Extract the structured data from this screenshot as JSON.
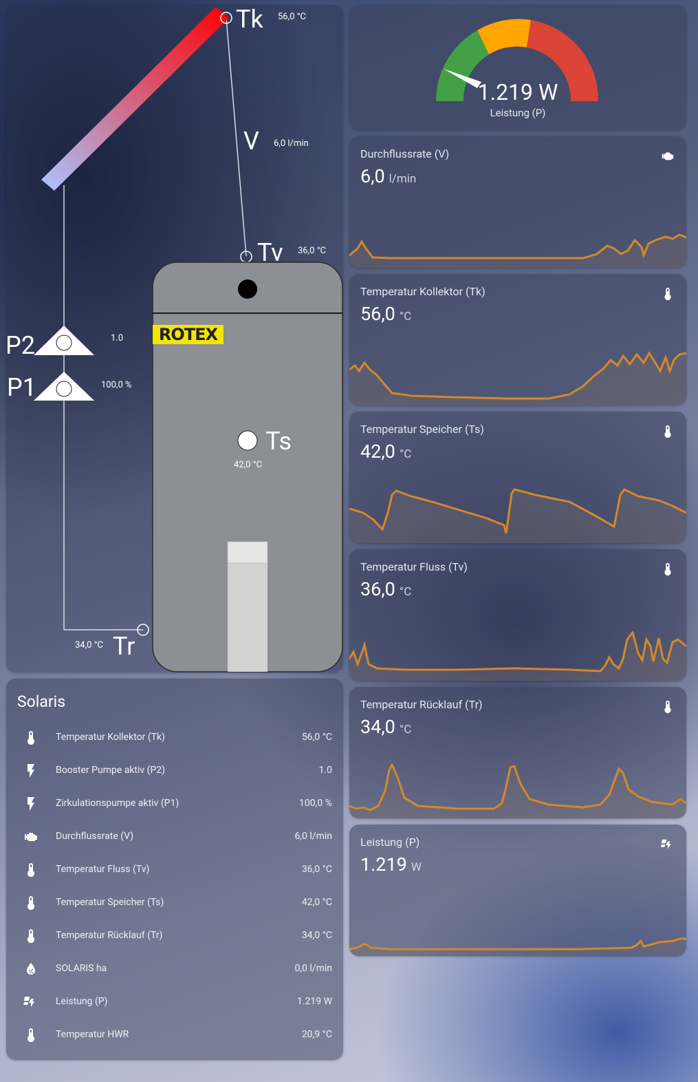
{
  "diagram": {
    "tk": {
      "label": "Tk",
      "value": "56,0 °C"
    },
    "v": {
      "label": "V",
      "value": "6,0 l/min"
    },
    "tv": {
      "label": "Tv",
      "value": "36,0 °C"
    },
    "p2": {
      "label": "P2",
      "value": "1.0"
    },
    "p1": {
      "label": "P1",
      "value": "100,0 %"
    },
    "ts": {
      "label": "Ts",
      "value": "42,0 °C"
    },
    "tr": {
      "label": "Tr",
      "value": "34,0 °C"
    },
    "brand": "ROTEX"
  },
  "gauge": {
    "value": "1.219 W",
    "name": "Leistung (P)",
    "colors": [
      "#43a047",
      "#ffa600",
      "#db4437"
    ]
  },
  "sensors": [
    {
      "name": "Durchflussrate (V)",
      "value": "6,0",
      "unit": "l/min",
      "icon": "pump-icon"
    },
    {
      "name": "Temperatur Kollektor (Tk)",
      "value": "56,0",
      "unit": "°C",
      "icon": "thermometer-icon"
    },
    {
      "name": "Temperatur Speicher (Ts)",
      "value": "42,0",
      "unit": "°C",
      "icon": "thermometer-icon"
    },
    {
      "name": "Temperatur Fluss (Tv)",
      "value": "36,0",
      "unit": "°C",
      "icon": "thermometer-icon"
    },
    {
      "name": "Temperatur Rücklauf (Tr)",
      "value": "34,0",
      "unit": "°C",
      "icon": "thermometer-icon"
    },
    {
      "name": "Leistung (P)",
      "value": "1.219",
      "unit": "W",
      "icon": "solar-power-icon"
    }
  ],
  "list": {
    "title": "Solaris",
    "rows": [
      {
        "name": "Temperatur Kollektor (Tk)",
        "value": "56,0 °C",
        "icon": "thermometer-icon"
      },
      {
        "name": "Booster Pumpe aktiv (P2)",
        "value": "1.0",
        "icon": "flash-icon"
      },
      {
        "name": "Zirkulationspumpe aktiv (P1)",
        "value": "100,0 %",
        "icon": "flash-icon"
      },
      {
        "name": "Durchflussrate (V)",
        "value": "6,0 l/min",
        "icon": "pump-icon"
      },
      {
        "name": "Temperatur Fluss (Tv)",
        "value": "36,0 °C",
        "icon": "thermometer-icon"
      },
      {
        "name": "Temperatur Speicher (Ts)",
        "value": "42,0 °C",
        "icon": "thermometer-icon"
      },
      {
        "name": "Temperatur Rücklauf (Tr)",
        "value": "34,0 °C",
        "icon": "thermometer-icon"
      },
      {
        "name": "SOLARIS ha",
        "value": "0,0 l/min",
        "icon": "water-percent-icon"
      },
      {
        "name": "Leistung (P)",
        "value": "1.219 W",
        "icon": "solar-power-icon"
      },
      {
        "name": "Temperatur HWR",
        "value": "20,9 °C",
        "icon": "thermometer-icon"
      }
    ]
  },
  "colors": {
    "graph_line": "#d4882a",
    "accent": "#ffffff"
  }
}
